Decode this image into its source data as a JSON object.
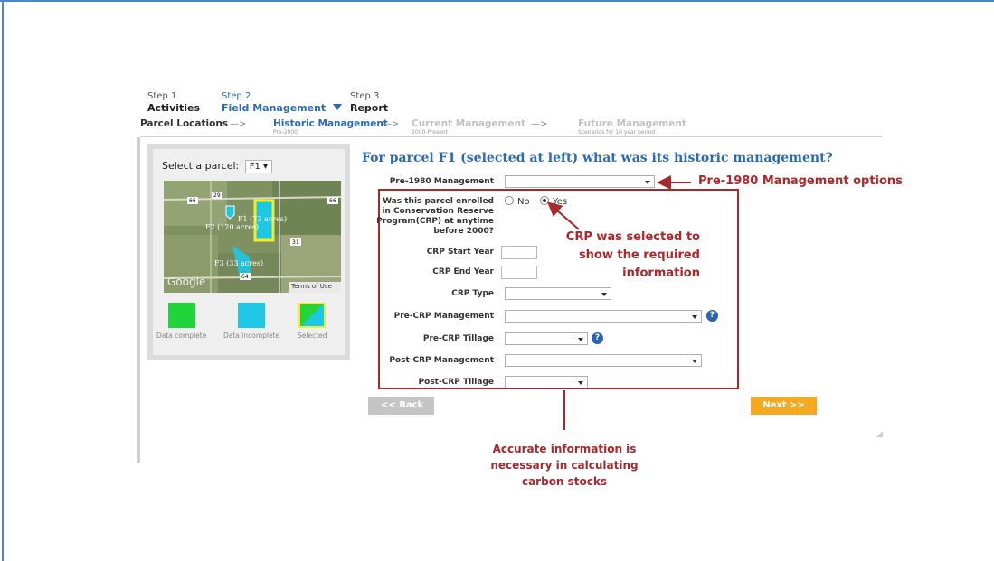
{
  "steps": [
    {
      "num": "Step 1",
      "label": "Activities"
    },
    {
      "num": "Step 2",
      "label": "Field Management"
    },
    {
      "num": "Step 3",
      "label": "Report"
    }
  ],
  "substeps": [
    {
      "title": "Parcel Locations",
      "sub": ""
    },
    {
      "title": "Historic Management",
      "sub": "Pre-2000"
    },
    {
      "title": "Current Management",
      "sub": "2000-Present"
    },
    {
      "title": "Future Management",
      "sub": "Scenarios for 10 year period"
    }
  ],
  "arrow": "—>",
  "left_panel": {
    "select_label": "Select a parcel:",
    "selected_parcel": "F1",
    "map": {
      "road_labels": [
        "66",
        "29",
        "66",
        "31",
        "64"
      ],
      "field_labels": [
        "F1 (73 acres)",
        "F2 (120 acres)",
        "F3 (33 acres)"
      ],
      "google": "Google",
      "terms": "Terms of Use"
    },
    "legend": [
      {
        "label": "Data complete",
        "color": "#22d43c"
      },
      {
        "label": "Data incomplete",
        "color": "#1ec7e6"
      },
      {
        "label": "Selected",
        "color": "#1ec7e6"
      }
    ]
  },
  "title": "For parcel F1 (selected at left) what was its historic management?",
  "form": {
    "pre1980_label": "Pre-1980 Management",
    "crp_question": "Was this parcel enrolled in Conservation Reserve Program(CRP) at anytime before 2000?",
    "radio_no": "No",
    "radio_yes": "Yes",
    "crp_start_label": "CRP Start Year",
    "crp_end_label": "CRP End Year",
    "crp_type_label": "CRP Type",
    "pre_crp_mgmt_label": "Pre-CRP Management",
    "pre_crp_tillage_label": "Pre-CRP Tillage",
    "post_crp_mgmt_label": "Post-CRP Management",
    "post_crp_tillage_label": "Post-CRP Tillage",
    "help_glyph": "?"
  },
  "buttons": {
    "back": "<< Back",
    "next": "Next >>"
  },
  "callouts": {
    "pre1980": "Pre-1980 Management options",
    "crp": "CRP was selected to show the required information",
    "accurate": "Accurate information is necessary in calculating carbon stocks"
  },
  "colors": {
    "accent": "#2a6ab6",
    "callout": "#a8282b",
    "next": "#f4a920"
  }
}
